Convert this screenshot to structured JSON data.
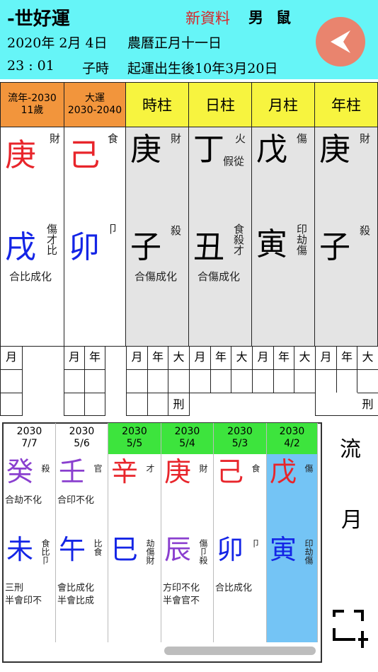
{
  "header": {
    "name": "-世好運",
    "new_record": "新資料",
    "gender": "男",
    "zodiac": "鼠",
    "date": "2020年 2月 4日",
    "lunar": "農曆正月十一日",
    "time": "23 : 01",
    "hour": "子時",
    "luck_start": "起運出生後10年3月20日",
    "bg_color": "#66f5f7"
  },
  "pillar_headers": {
    "year_flow": "流年-2030",
    "year_flow_age": "11歲",
    "big_luck": "大運",
    "big_luck_range": "2030-2040",
    "hour": "時柱",
    "day": "日柱",
    "month": "月柱",
    "year": "年柱"
  },
  "pillars": [
    {
      "stem": "庚",
      "stem_color": "#e8252b",
      "stem_god": "財",
      "branch": "戌",
      "branch_color": "#1425e6",
      "branch_gods": "傷才比",
      "note": "合比成化"
    },
    {
      "stem": "己",
      "stem_color": "#e8252b",
      "stem_god": "食",
      "branch": "卯",
      "branch_color": "#1425e6",
      "branch_gods": "卩",
      "note": ""
    },
    {
      "stem": "庚",
      "stem_color": "#000000",
      "stem_god": "財",
      "branch": "子",
      "branch_color": "#000000",
      "branch_gods": "殺",
      "note": "合傷成化"
    },
    {
      "stem": "丁",
      "stem_color": "#000000",
      "stem_god": "火",
      "stem_god2": "假從",
      "branch": "丑",
      "branch_color": "#000000",
      "branch_gods": "食殺才",
      "note": "合傷成化"
    },
    {
      "stem": "戊",
      "stem_color": "#000000",
      "stem_god": "傷",
      "branch": "寅",
      "branch_color": "#000000",
      "branch_gods": "印劫傷",
      "note": ""
    },
    {
      "stem": "庚",
      "stem_color": "#000000",
      "stem_god": "財",
      "branch": "子",
      "branch_color": "#000000",
      "branch_gods": "殺",
      "note": ""
    }
  ],
  "relation_grid": {
    "labels_year_flow": [
      "月"
    ],
    "labels_big_luck": [
      "月",
      "年"
    ],
    "labels_pillars": [
      "月",
      "年",
      "大"
    ],
    "clash_hour": "刑",
    "clash_year": "刑"
  },
  "flow_months": [
    {
      "year": "2030",
      "date": "7/7",
      "stem": "癸",
      "stem_color": "#8a3fcf",
      "stem_god": "殺",
      "stem_note": "合劫不化",
      "branch": "未",
      "branch_color": "#1425e6",
      "branch_gods": "食比卩",
      "branch_note1": "三刑",
      "branch_note2": "半會印不"
    },
    {
      "year": "2030",
      "date": "5/6",
      "stem": "壬",
      "stem_color": "#8a3fcf",
      "stem_god": "官",
      "stem_note": "合印不化",
      "branch": "午",
      "branch_color": "#1425e6",
      "branch_gods": "比食",
      "branch_note1": "會比成化",
      "branch_note2": "半會比成"
    },
    {
      "year": "2030",
      "date": "5/5",
      "stem": "辛",
      "stem_color": "#e8252b",
      "stem_god": "才",
      "stem_note": "",
      "branch": "巳",
      "branch_color": "#1425e6",
      "branch_gods": "劫傷財",
      "branch_note1": "",
      "branch_note2": ""
    },
    {
      "year": "2030",
      "date": "5/4",
      "stem": "庚",
      "stem_color": "#e8252b",
      "stem_god": "財",
      "stem_note": "",
      "branch": "辰",
      "branch_color": "#8a3fcf",
      "branch_gods": "傷卩殺",
      "branch_note1": "方印不化",
      "branch_note2": "半會官不"
    },
    {
      "year": "2030",
      "date": "5/3",
      "stem": "己",
      "stem_color": "#e8252b",
      "stem_god": "食",
      "stem_note": "",
      "branch": "卯",
      "branch_color": "#1425e6",
      "branch_gods": "卩",
      "branch_note1": "合比成化",
      "branch_note2": ""
    },
    {
      "year": "2030",
      "date": "4/2",
      "stem": "戊",
      "stem_color": "#e8252b",
      "stem_god": "傷",
      "stem_note": "",
      "branch": "寅",
      "branch_color": "#1425e6",
      "branch_gods": "印劫傷",
      "branch_note1": "",
      "branch_note2": ""
    }
  ],
  "side_panel": {
    "label1": "流",
    "label2": "月"
  }
}
